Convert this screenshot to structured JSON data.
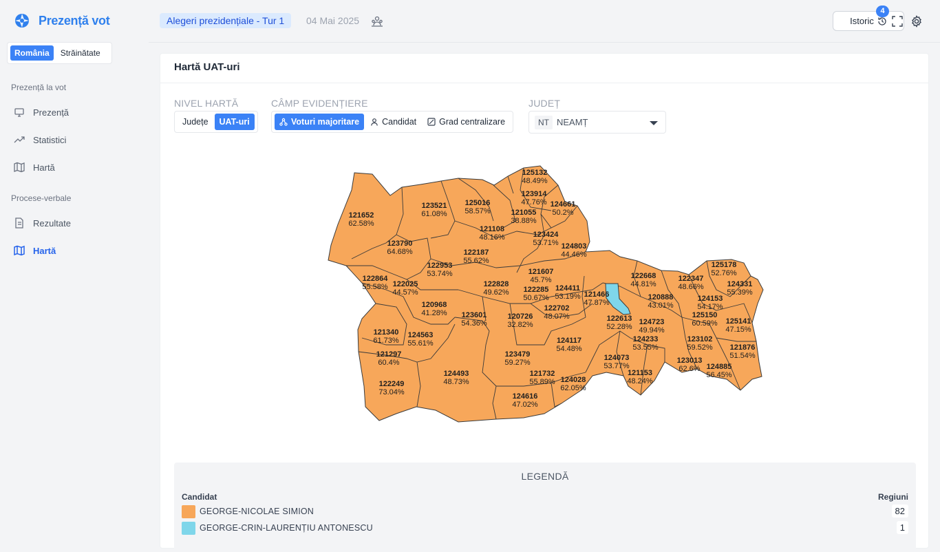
{
  "app": {
    "name": "Prezență vot"
  },
  "scope": {
    "options": [
      "România",
      "Străinătate"
    ],
    "selected": "România"
  },
  "sidebar": {
    "sections": [
      {
        "title": "Prezență la vot",
        "items": [
          {
            "label": "Prezență"
          },
          {
            "label": "Statistici"
          },
          {
            "label": "Hartă"
          }
        ]
      },
      {
        "title": "Procese-verbale",
        "items": [
          {
            "label": "Rezultate"
          },
          {
            "label": "Hartă"
          }
        ]
      }
    ],
    "active": "Procese-verbale / Hartă"
  },
  "header": {
    "election": "Alegeri prezidențiale - Tur 1",
    "date": "04 Mai 2025",
    "history_label": "Istoric",
    "history_count": "4"
  },
  "card": {
    "title": "Hartă UAT-uri",
    "map_level": {
      "label": "NIVEL HARTĂ",
      "options": [
        "Județe",
        "UAT-uri"
      ],
      "selected": "UAT-uri"
    },
    "highlight": {
      "label": "CÂMP EVIDENȚIERE",
      "options": [
        "Voturi majoritare",
        "Candidat",
        "Grad centralizare"
      ],
      "selected": "Voturi majoritare"
    },
    "county": {
      "label": "JUDEȚ",
      "code": "NT",
      "name": "NEAMȚ"
    }
  },
  "colors": {
    "simion": "#f7a75a",
    "antonescu": "#7fd6ea",
    "accent": "#3b82f6"
  },
  "map_regions": [
    {
      "id": "125132",
      "pct": "48.49%",
      "winner": "simion"
    },
    {
      "id": "123914",
      "pct": "47.76%",
      "winner": "simion"
    },
    {
      "id": "125016",
      "pct": "58.57%",
      "winner": "simion"
    },
    {
      "id": "124661",
      "pct": "50.2%",
      "winner": "simion"
    },
    {
      "id": "121055",
      "pct": "38.88%",
      "winner": "simion"
    },
    {
      "id": "123521",
      "pct": "61.08%",
      "winner": "simion"
    },
    {
      "id": "121652",
      "pct": "62.58%",
      "winner": "simion"
    },
    {
      "id": "121108",
      "pct": "48.16%",
      "winner": "simion"
    },
    {
      "id": "123424",
      "pct": "53.71%",
      "winner": "simion"
    },
    {
      "id": "124803",
      "pct": "44.46%",
      "winner": "simion"
    },
    {
      "id": "123790",
      "pct": "64.68%",
      "winner": "simion"
    },
    {
      "id": "122187",
      "pct": "55.62%",
      "winner": "simion"
    },
    {
      "id": "122953",
      "pct": "53.74%",
      "winner": "simion"
    },
    {
      "id": "121607",
      "pct": "45.7%",
      "winner": "simion"
    },
    {
      "id": "125178",
      "pct": "52.76%",
      "winner": "simion"
    },
    {
      "id": "122864",
      "pct": "55.58%",
      "winner": "simion"
    },
    {
      "id": "122668",
      "pct": "44.81%",
      "winner": "simion"
    },
    {
      "id": "122347",
      "pct": "48.66%",
      "winner": "simion"
    },
    {
      "id": "124331",
      "pct": "55.39%",
      "winner": "simion"
    },
    {
      "id": "122025",
      "pct": "44.57%",
      "winner": "simion"
    },
    {
      "id": "122828",
      "pct": "49.62%",
      "winner": "simion"
    },
    {
      "id": "124411",
      "pct": "53.19%",
      "winner": "simion"
    },
    {
      "id": "122285",
      "pct": "50.67%",
      "winner": "simion"
    },
    {
      "id": "121466",
      "pct": "47.87%",
      "winner": "simion"
    },
    {
      "id": "120888",
      "pct": "43.01%",
      "winner": "simion"
    },
    {
      "id": "124153",
      "pct": "54.17%",
      "winner": "simion"
    },
    {
      "id": "120968",
      "pct": "41.28%",
      "winner": "simion"
    },
    {
      "id": "122702",
      "pct": "48.07%",
      "winner": "simion"
    },
    {
      "id": "123601",
      "pct": "54.36%",
      "winner": "simion"
    },
    {
      "id": "120726",
      "pct": "32.82%",
      "winner": "simion"
    },
    {
      "id": "122613",
      "pct": "52.28%",
      "winner": "simion"
    },
    {
      "id": "125150",
      "pct": "60.59%",
      "winner": "simion"
    },
    {
      "id": "125141",
      "pct": "47.15%",
      "winner": "simion"
    },
    {
      "id": "124723",
      "pct": "49.94%",
      "winner": "simion"
    },
    {
      "id": "121340",
      "pct": "61.73%",
      "winner": "simion"
    },
    {
      "id": "124563",
      "pct": "55.61%",
      "winner": "simion"
    },
    {
      "id": "124233",
      "pct": "53.55%",
      "winner": "simion"
    },
    {
      "id": "123102",
      "pct": "59.52%",
      "winner": "simion"
    },
    {
      "id": "124117",
      "pct": "54.48%",
      "winner": "simion"
    },
    {
      "id": "121876",
      "pct": "51.54%",
      "winner": "simion"
    },
    {
      "id": "121297",
      "pct": "60.4%",
      "winner": "simion"
    },
    {
      "id": "123479",
      "pct": "59.27%",
      "winner": "simion"
    },
    {
      "id": "124073",
      "pct": "53.77%",
      "winner": "simion"
    },
    {
      "id": "123013",
      "pct": "62.6%",
      "winner": "simion"
    },
    {
      "id": "124885",
      "pct": "56.45%",
      "winner": "simion"
    },
    {
      "id": "124493",
      "pct": "48.73%",
      "winner": "simion"
    },
    {
      "id": "121732",
      "pct": "55.89%",
      "winner": "simion"
    },
    {
      "id": "121153",
      "pct": "48.24%",
      "winner": "simion"
    },
    {
      "id": "124028",
      "pct": "62.05%",
      "winner": "simion"
    },
    {
      "id": "122249",
      "pct": "73.04%",
      "winner": "simion"
    },
    {
      "id": "124616",
      "pct": "47.02%",
      "winner": "simion"
    }
  ],
  "legend": {
    "title": "LEGENDĂ",
    "col_candidate": "Candidat",
    "col_regions": "Regiuni",
    "rows": [
      {
        "name": "GEORGE-NICOLAE SIMION",
        "count": "82",
        "color": "#f7a75a"
      },
      {
        "name": "GEORGE-CRIN-LAURENȚIU ANTONESCU",
        "count": "1",
        "color": "#7fd6ea"
      }
    ]
  }
}
